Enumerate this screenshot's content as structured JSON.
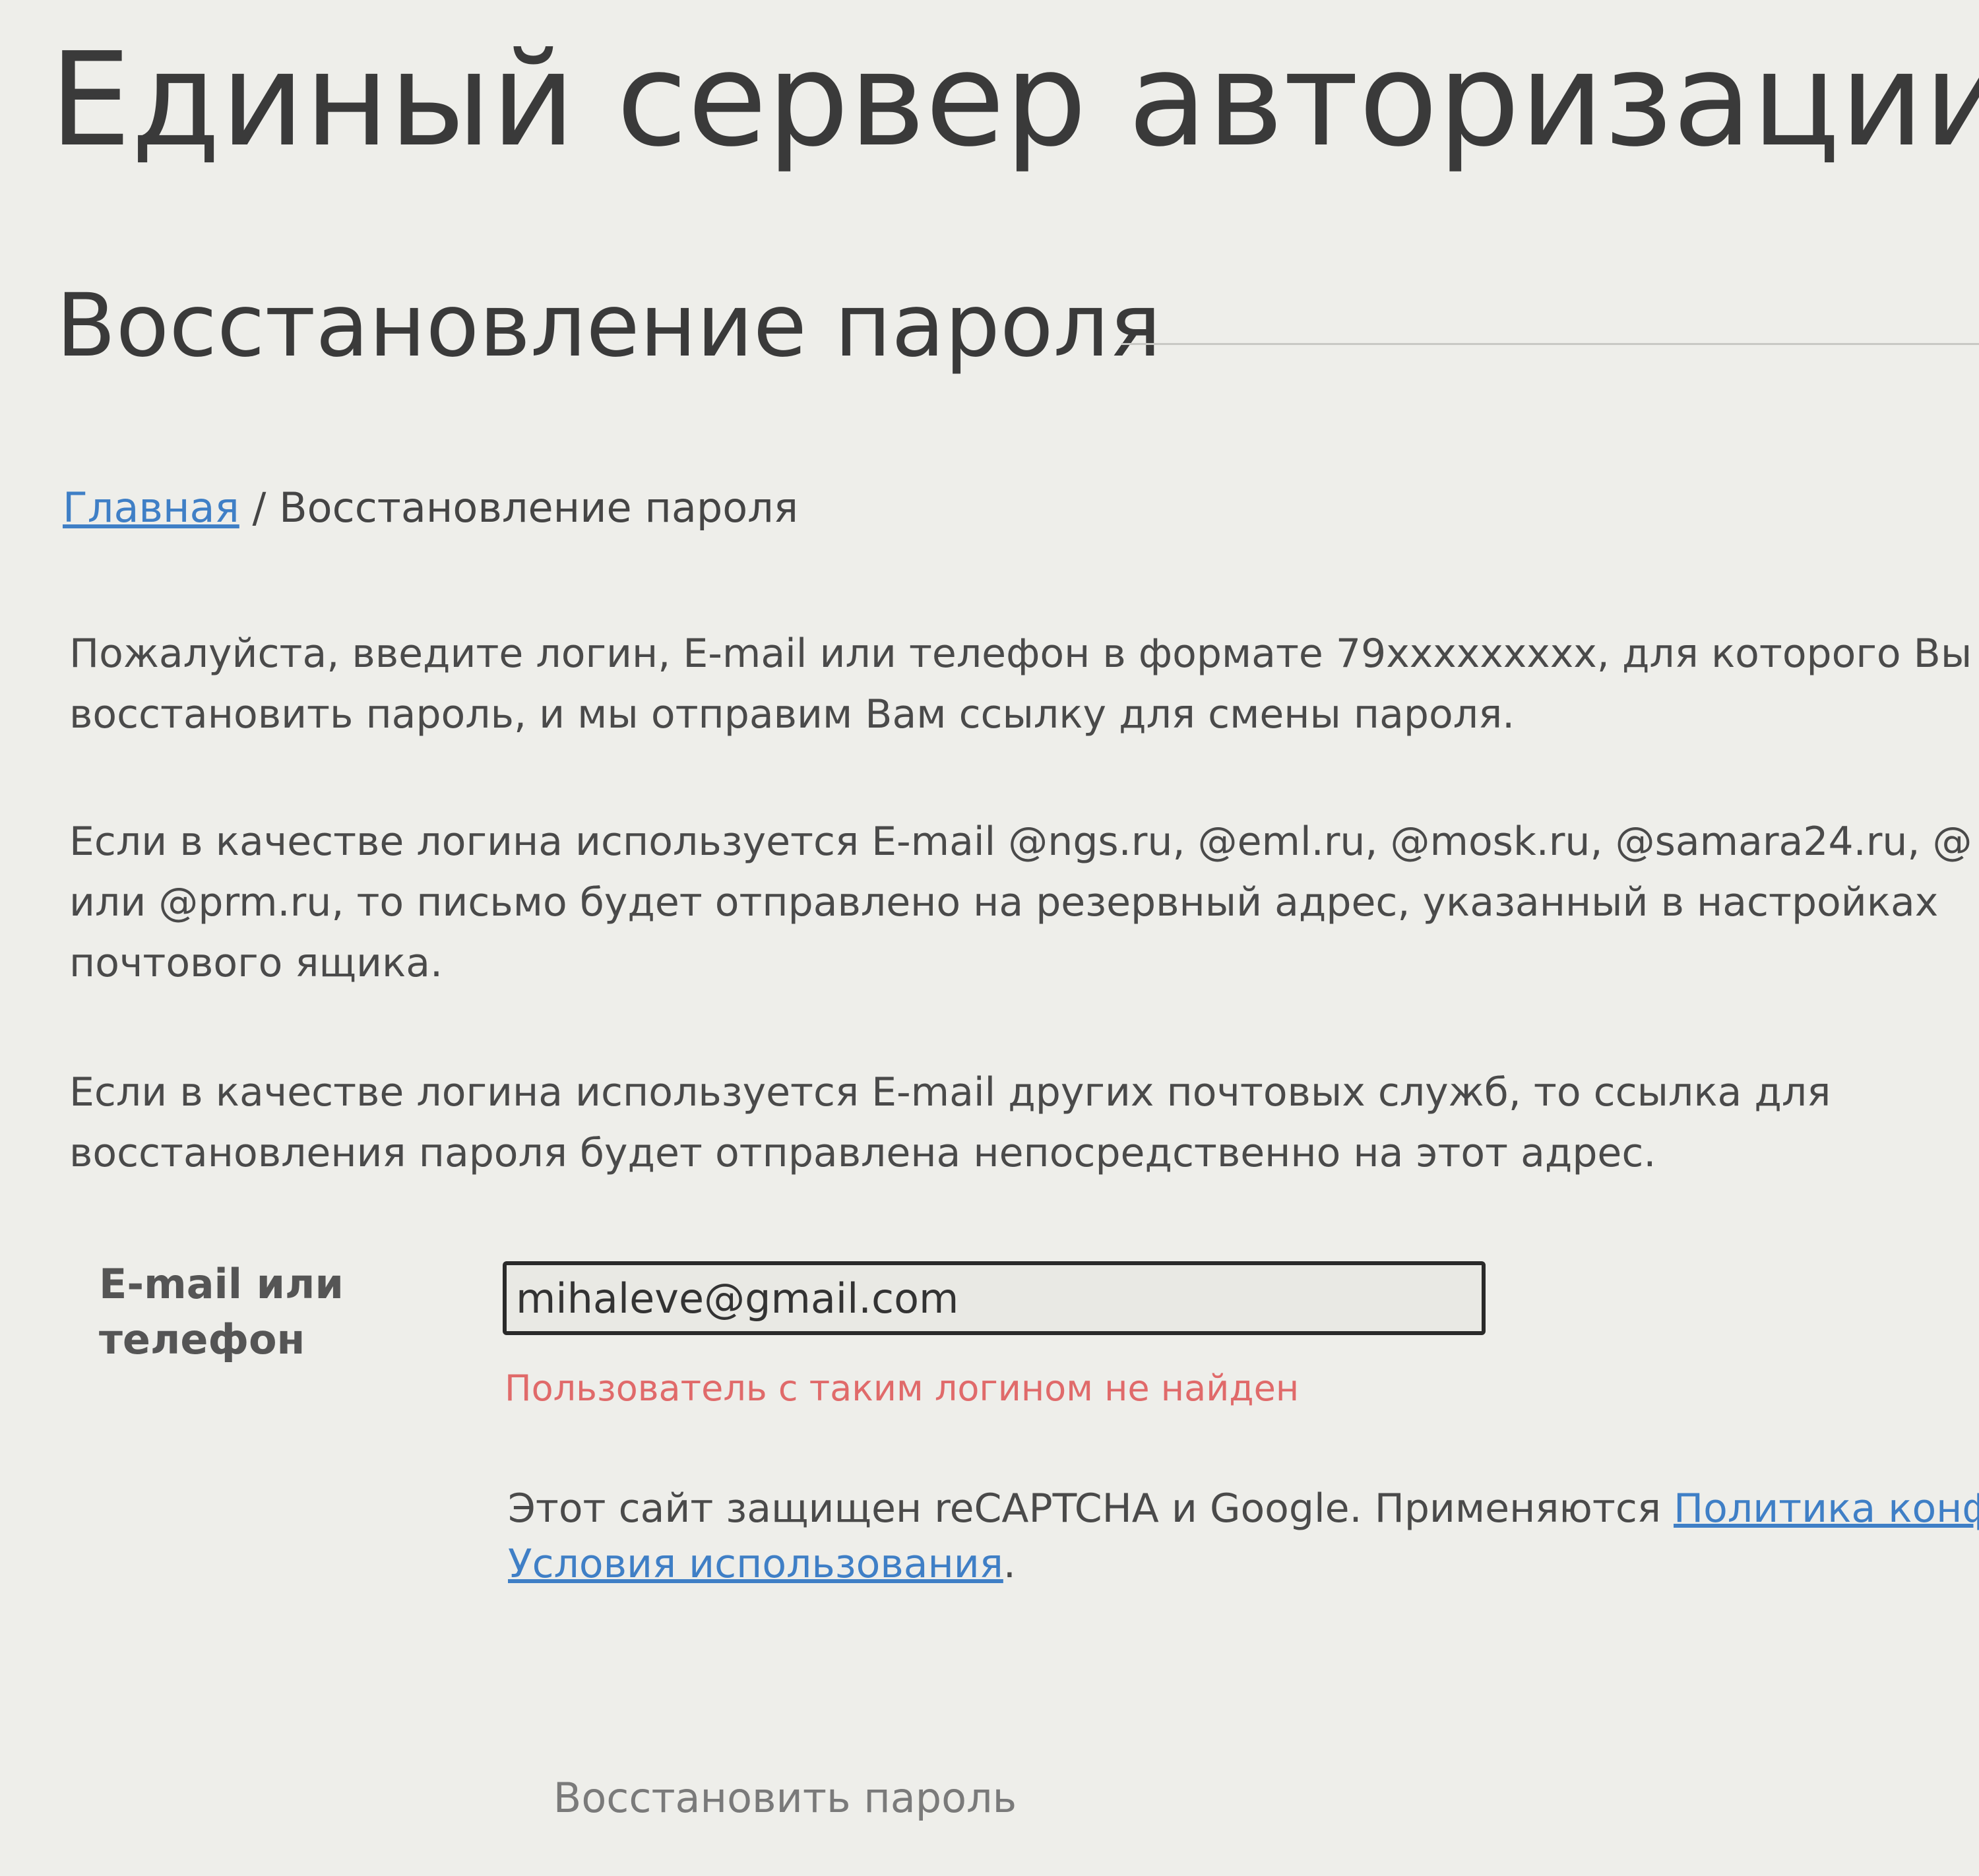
{
  "site_title": "Единый сервер авторизации",
  "page_title": "Восстановление пароля",
  "breadcrumb": {
    "home_label": "Главная",
    "separator": "/",
    "current": "Восстановление пароля"
  },
  "intro": {
    "line1": "Пожалуйста, введите логин, E-mail или телефон в формате 79xxxxxxxxx, для которого Вы",
    "line2": "восстановить пароль, и мы отправим Вам ссылку для смены пароля."
  },
  "ngs_note": {
    "line1": "Если в качестве логина используется E-mail @ngs.ru, @eml.ru, @mosk.ru, @samara24.ru, @",
    "line2": "или @prm.ru, то письмо будет отправлено на резервный адрес, указанный в настройках",
    "line3": "почтового ящика."
  },
  "other_note": {
    "line1": "Если в качестве логина используется E-mail других почтовых служб, то ссылка для",
    "line2": "восстановления пароля будет отправлена непосредственно на этот адрес."
  },
  "form": {
    "label_line1": "E-mail или",
    "label_line2": "телефон",
    "value": "mihaleve@gmail.com",
    "error": "Пользователь с таким логином не найден"
  },
  "recaptcha": {
    "text": "Этот сайт защищен reCAPTCHA и Google. Применяются ",
    "privacy_link": "Политика конфиде",
    "terms_link": "Условия использования",
    "end": "."
  },
  "submit_label": "Восстановить пароль",
  "colors": {
    "background": "#eeeeea",
    "link": "#3f7fc6",
    "error": "#e06a6a"
  }
}
